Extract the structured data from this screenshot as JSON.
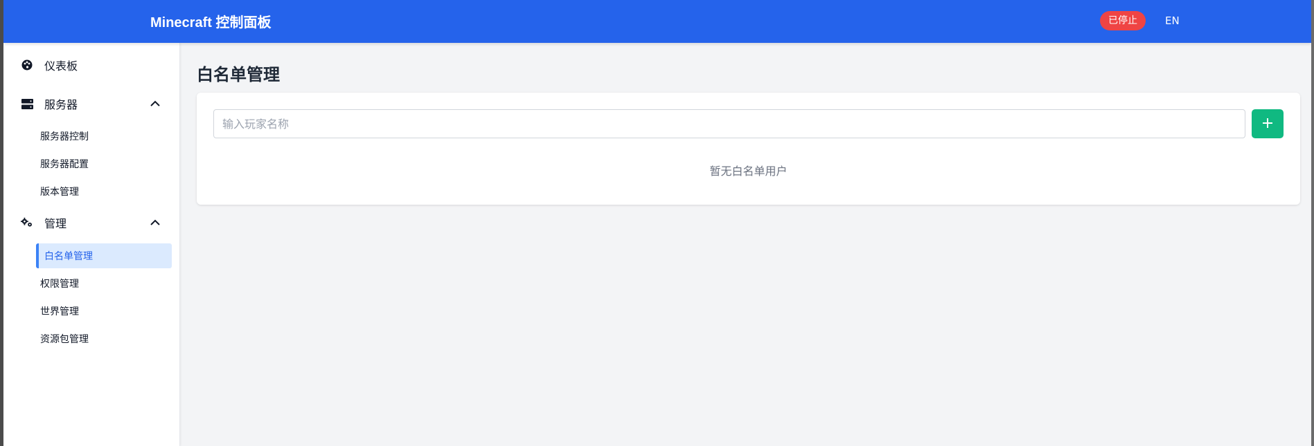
{
  "header": {
    "title": "Minecraft 控制面板",
    "status": "已停止",
    "language": "EN",
    "colors": {
      "bar": "#2563eb",
      "status": "#ef4444"
    }
  },
  "sidebar": {
    "dashboard": {
      "label": "仪表板",
      "icon": "palette-icon"
    },
    "server": {
      "label": "服务器",
      "icon": "server-icon",
      "items": [
        "服务器控制",
        "服务器配置",
        "版本管理"
      ]
    },
    "management": {
      "label": "管理",
      "icon": "gears-icon",
      "items": [
        "白名单管理",
        "权限管理",
        "世界管理",
        "资源包管理"
      ],
      "active_item": "白名单管理"
    }
  },
  "main": {
    "title": "白名单管理",
    "input_placeholder": "输入玩家名称",
    "input_value": "",
    "add_icon": "plus-icon",
    "add_color": "#10b981",
    "empty_text": "暂无白名单用户"
  }
}
